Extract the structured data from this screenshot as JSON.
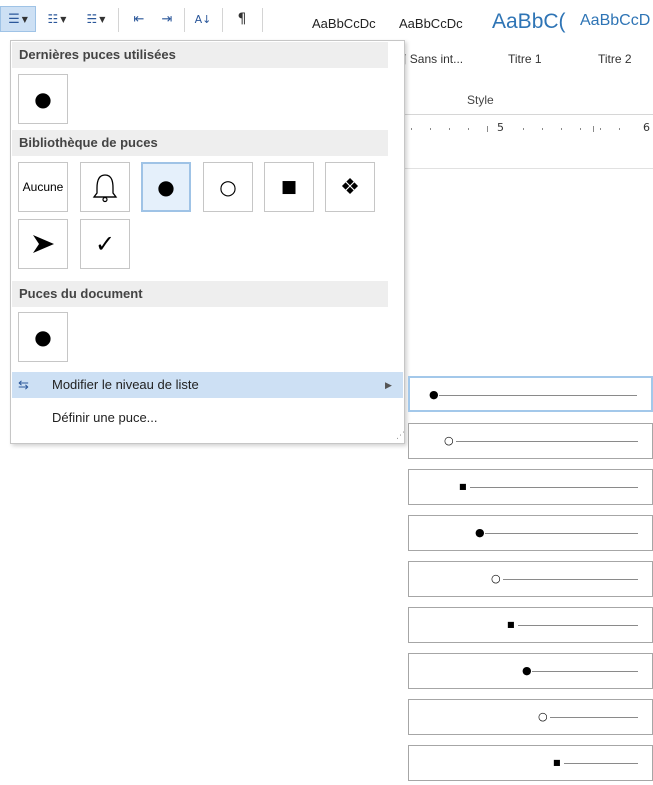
{
  "ribbon": {
    "styles": [
      {
        "preview": "AaBbCcDc",
        "name": ""
      },
      {
        "preview": "AaBbCcDc",
        "name": "¶ Sans int..."
      },
      {
        "preview": "AaBbC(",
        "name": "Titre 1"
      },
      {
        "preview": "AaBbCcD",
        "name": "Titre 2"
      }
    ],
    "style_group_label": "Style",
    "ruler_mark": "5",
    "ruler_mark2": "6"
  },
  "panel": {
    "recent_header": "Dernières puces utilisées",
    "library_header": "Bibliothèque de puces",
    "document_header": "Puces du document",
    "none_label": "Aucune",
    "recent_bullet": "●",
    "library_bullets": [
      "●",
      "○",
      "■",
      "❖",
      "➤",
      "✓"
    ],
    "document_bullet": "●",
    "change_level": "Modifier le niveau de liste",
    "define_bullet": "Définir une puce..."
  },
  "levels": [
    {
      "bullet": "●"
    },
    {
      "bullet": "○"
    },
    {
      "bullet": "■"
    },
    {
      "bullet": "●"
    },
    {
      "bullet": "○"
    },
    {
      "bullet": "■"
    },
    {
      "bullet": "●"
    },
    {
      "bullet": "○"
    },
    {
      "bullet": "■"
    }
  ],
  "colors": {
    "accent": "#2b579a",
    "highlight": "#cde0f4",
    "selected_border": "#9fc3e6",
    "style_blue": "#2e74b5"
  }
}
